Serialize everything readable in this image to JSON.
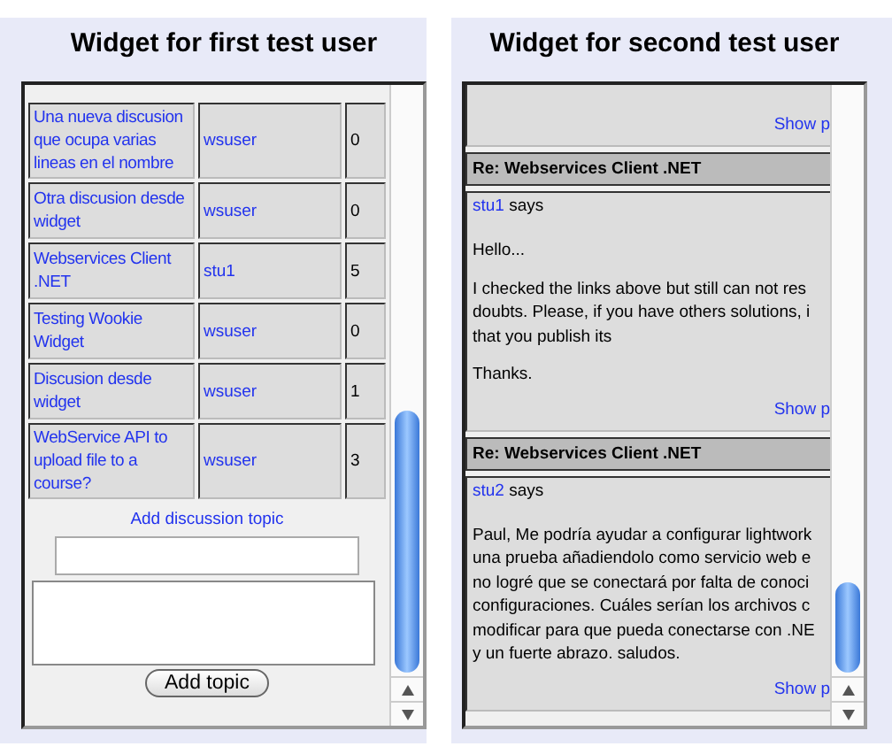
{
  "widgets": [
    {
      "title": "Widget for first test user",
      "kind": "topics",
      "rows": [
        {
          "topic": "Una nueva discusion que ocupa varias lineas en el nombre",
          "user": "wsuser",
          "count": "0"
        },
        {
          "topic": "Otra discusion desde widget",
          "user": "wsuser",
          "count": "0"
        },
        {
          "topic": "Webservices Client .NET",
          "user": "stu1",
          "count": "5"
        },
        {
          "topic": "Testing Wookie Widget",
          "user": "wsuser",
          "count": "0"
        },
        {
          "topic": "Discusion desde widget",
          "user": "wsuser",
          "count": "1"
        },
        {
          "topic": "WebService API to upload file to a course?",
          "user": "wsuser",
          "count": "3"
        }
      ],
      "add_link": "Add discussion topic",
      "button": "Add topic"
    },
    {
      "title": "Widget for second test user",
      "kind": "posts",
      "top_link": "Show p",
      "posts": [
        {
          "subject": "Re: Webservices Client .NET",
          "author": "stu1",
          "says": "says",
          "lines": [
            [
              "Hello..."
            ],
            [
              "I checked the links above but still can not res",
              "doubts. Please, if you have others solutions, i",
              "that you publish its"
            ],
            [
              "Thanks."
            ]
          ],
          "link": "Show p"
        },
        {
          "subject": "Re: Webservices Client .NET",
          "author": "stu2",
          "says": "says",
          "lines": [
            [
              "Paul, Me podría ayudar a configurar lightwork",
              "una prueba añadiendolo como servicio web e",
              "no logré que se conectará por falta de conoci",
              "configuraciones. Cuáles serían los archivos c",
              "modificar para que pueda conectarse con .NE",
              "y un fuerte abrazo. saludos."
            ]
          ],
          "link": "Show p"
        }
      ]
    }
  ]
}
